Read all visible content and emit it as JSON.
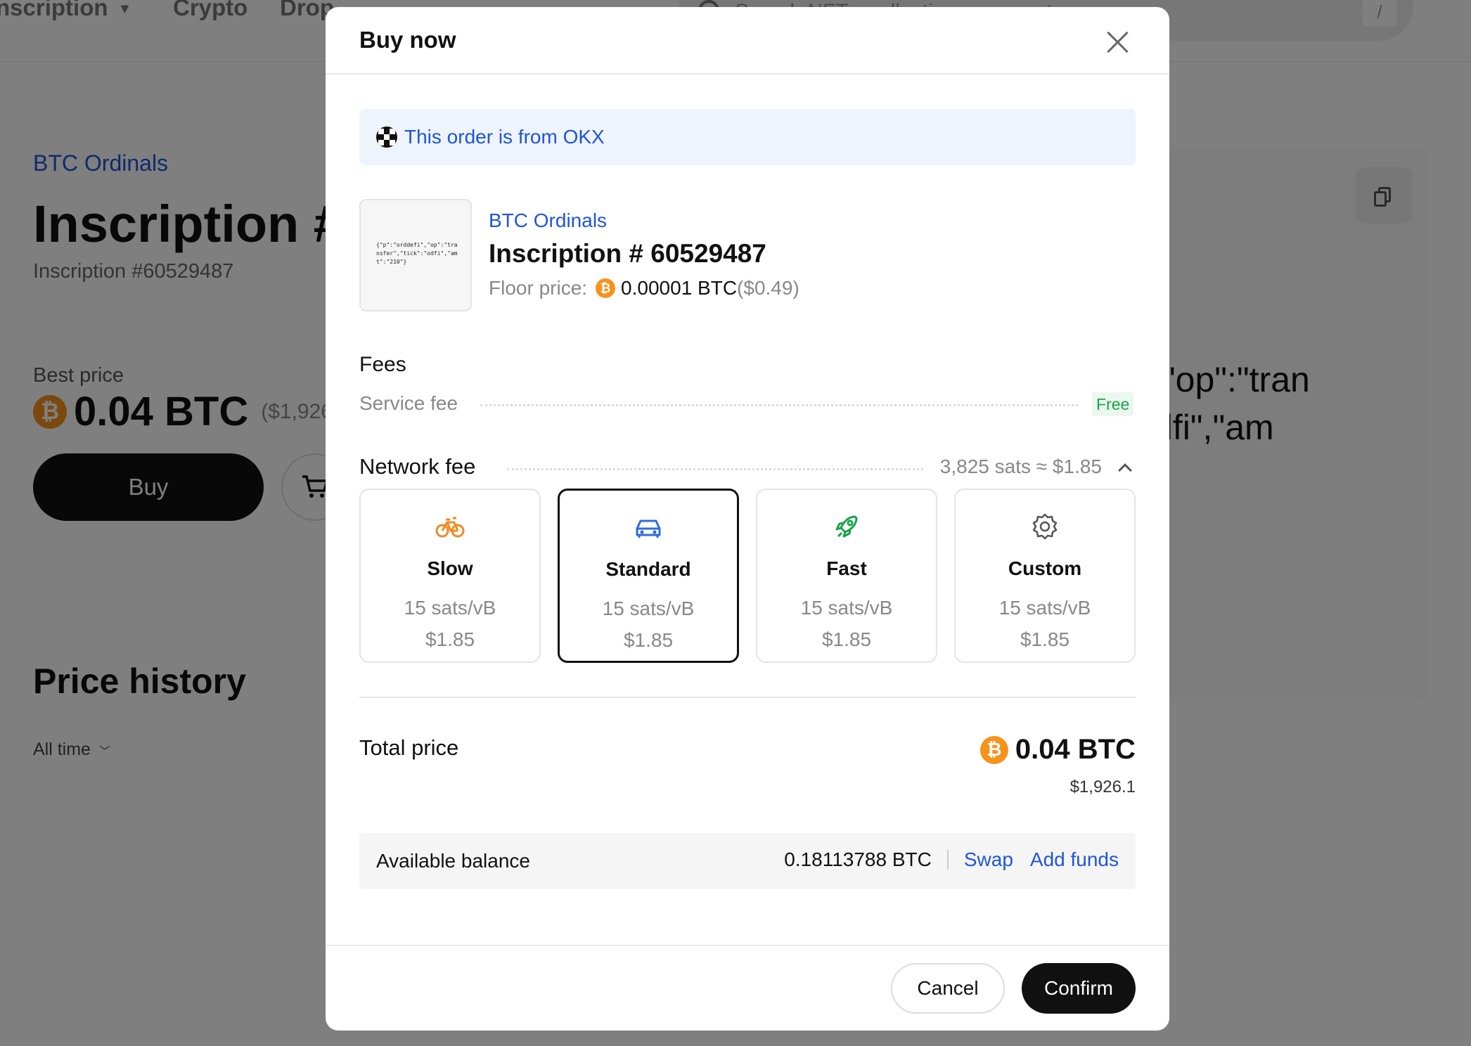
{
  "background": {
    "nav": {
      "items": [
        {
          "label": "nscription"
        },
        {
          "label": "Crypto"
        },
        {
          "label": "Drop"
        }
      ],
      "search_placeholder": "Search NFTs, collections, accounts",
      "search_shortcut": "/"
    },
    "breadcrumb": "BTC Ordinals",
    "title": "Inscription #",
    "subtitle": "Inscription #60529487",
    "best_price_label": "Best price",
    "best_price_btc": "0.04 BTC",
    "best_price_usd": "($1,926.",
    "buy_label": "Buy",
    "price_history_title": "Price history",
    "time_filter": "All time",
    "json_preview": ",\"op\":\"tran\ndfi\",\"am"
  },
  "modal": {
    "title": "Buy now",
    "notice": "This order is from OKX",
    "item": {
      "thumb_text": "{\"p\":\"orddefi\",\"op\":\"transfer\",\"tick\":\"odfi\",\"amt\":\"210\"}",
      "collection": "BTC Ordinals",
      "name": "Inscription  # 60529487",
      "floor_label": "Floor price:",
      "floor_btc": "0.00001 BTC",
      "floor_usd": "($0.49)"
    },
    "fees": {
      "title": "Fees",
      "service_label": "Service fee",
      "service_value": "Free",
      "network_label": "Network fee",
      "network_value": "3,825 sats ≈ $1.85",
      "options": [
        {
          "name": "Slow",
          "rate": "15 sats/vB",
          "usd": "$1.85",
          "icon": "bicycle-icon",
          "color": "#f08a24"
        },
        {
          "name": "Standard",
          "rate": "15 sats/vB",
          "usd": "$1.85",
          "icon": "car-icon",
          "color": "#2f6bdc",
          "selected": true
        },
        {
          "name": "Fast",
          "rate": "15 sats/vB",
          "usd": "$1.85",
          "icon": "rocket-icon",
          "color": "#1aa34a"
        },
        {
          "name": "Custom",
          "rate": "15 sats/vB",
          "usd": "$1.85",
          "icon": "gear-icon",
          "color": "#555555"
        }
      ]
    },
    "total": {
      "label": "Total price",
      "btc": "0.04 BTC",
      "usd": "$1,926.1"
    },
    "balance": {
      "label": "Available balance",
      "value": "0.18113788 BTC",
      "swap_label": "Swap",
      "add_funds_label": "Add funds"
    },
    "cancel_label": "Cancel",
    "confirm_label": "Confirm"
  },
  "colors": {
    "accent_blue": "#1f55d8",
    "btc_orange": "#f7931a",
    "free_green": "#1aa34a",
    "primary_button": "#111111"
  }
}
